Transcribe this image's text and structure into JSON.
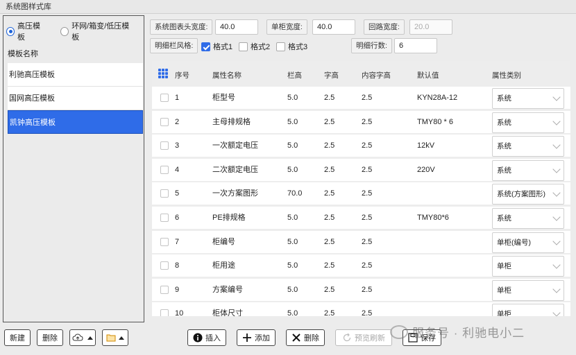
{
  "window": {
    "title": "系统图样式库"
  },
  "left": {
    "radios": [
      {
        "label": "高压模板",
        "checked": true
      },
      {
        "label": "环网/箱变/低压模板",
        "checked": false
      }
    ],
    "list_header": "模板名称",
    "templates": [
      {
        "name": "利驰高压模板",
        "selected": false
      },
      {
        "name": "国网高压模板",
        "selected": false
      },
      {
        "name": "凯钟高压模板",
        "selected": true
      }
    ]
  },
  "settings": {
    "header_width_label": "系统图表头宽度:",
    "header_width_value": "40.0",
    "cabinet_width_label": "单柜宽度:",
    "cabinet_width_value": "40.0",
    "circuit_width_label": "回路宽度:",
    "circuit_width_value": "20.0",
    "detail_style_label": "明细栏风格:",
    "styles": [
      {
        "label": "格式1",
        "checked": true
      },
      {
        "label": "格式2",
        "checked": false
      },
      {
        "label": "格式3",
        "checked": false
      }
    ],
    "detail_rows_label": "明细行数:",
    "detail_rows_value": "6"
  },
  "table": {
    "headers": [
      "序号",
      "属性名称",
      "栏高",
      "字高",
      "内容字高",
      "默认值",
      "属性类别"
    ],
    "rows": [
      {
        "no": "1",
        "name": "柜型号",
        "h": "5.0",
        "fh": "2.5",
        "ch": "2.5",
        "def": "KYN28A-12",
        "cat": "系统"
      },
      {
        "no": "2",
        "name": "主母排规格",
        "h": "5.0",
        "fh": "2.5",
        "ch": "2.5",
        "def": "TMY80 * 6",
        "cat": "系统"
      },
      {
        "no": "3",
        "name": "一次额定电压",
        "h": "5.0",
        "fh": "2.5",
        "ch": "2.5",
        "def": "12kV",
        "cat": "系统"
      },
      {
        "no": "4",
        "name": "二次额定电压",
        "h": "5.0",
        "fh": "2.5",
        "ch": "2.5",
        "def": "220V",
        "cat": "系统"
      },
      {
        "no": "5",
        "name": "一次方案图形",
        "h": "70.0",
        "fh": "2.5",
        "ch": "2.5",
        "def": "",
        "cat": "系统(方案图形)"
      },
      {
        "no": "6",
        "name": "PE排规格",
        "h": "5.0",
        "fh": "2.5",
        "ch": "2.5",
        "def": "TMY80*6",
        "cat": "系统"
      },
      {
        "no": "7",
        "name": "柜编号",
        "h": "5.0",
        "fh": "2.5",
        "ch": "2.5",
        "def": "",
        "cat": "单柜(编号)"
      },
      {
        "no": "8",
        "name": "柜用途",
        "h": "5.0",
        "fh": "2.5",
        "ch": "2.5",
        "def": "",
        "cat": "单柜"
      },
      {
        "no": "9",
        "name": "方案编号",
        "h": "5.0",
        "fh": "2.5",
        "ch": "2.5",
        "def": "",
        "cat": "单柜"
      },
      {
        "no": "10",
        "name": "柜体尺寸",
        "h": "5.0",
        "fh": "2.5",
        "ch": "2.5",
        "def": "",
        "cat": "单柜"
      }
    ]
  },
  "bottom": {
    "new": "新建",
    "delete_left": "删除",
    "insert": "插入",
    "add": "添加",
    "delete": "删除",
    "preview_refresh": "预览刷新",
    "save": "保存"
  },
  "watermark": "服务号 · 利驰电小二",
  "colors": {
    "accent": "#2f6ce8"
  }
}
